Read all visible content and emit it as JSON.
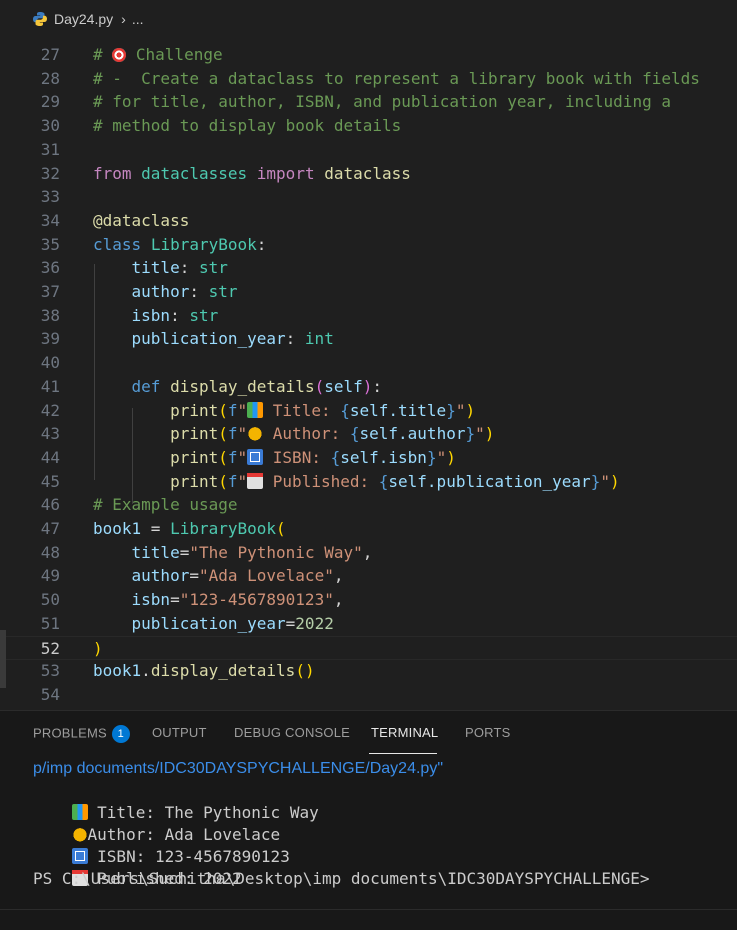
{
  "breadcrumb": {
    "file": "Day24.py",
    "ellipsis": "..."
  },
  "editor": {
    "cut_line_number": "26",
    "active_line": 52,
    "lines": [
      {
        "n": "27",
        "tokens": [
          [
            "c-com",
            "# "
          ],
          [
            "target-emoji",
            ""
          ],
          [
            "c-com",
            " Challenge"
          ]
        ]
      },
      {
        "n": "28",
        "tokens": [
          [
            "c-com",
            "# -  Create a dataclass to represent a library book with fields"
          ]
        ]
      },
      {
        "n": "29",
        "tokens": [
          [
            "c-com",
            "# for title, author, ISBN, and publication year, including a"
          ]
        ]
      },
      {
        "n": "30",
        "tokens": [
          [
            "c-com",
            "# method to display book details"
          ]
        ]
      },
      {
        "n": "31",
        "tokens": []
      },
      {
        "n": "32",
        "tokens": [
          [
            "c-imp",
            "from"
          ],
          [
            "c-txt",
            " "
          ],
          [
            "c-cls",
            "dataclasses"
          ],
          [
            "c-txt",
            " "
          ],
          [
            "c-imp",
            "import"
          ],
          [
            "c-txt",
            " "
          ],
          [
            "c-fn",
            "dataclass"
          ]
        ]
      },
      {
        "n": "33",
        "tokens": []
      },
      {
        "n": "34",
        "tokens": [
          [
            "c-fn",
            "@dataclass"
          ]
        ]
      },
      {
        "n": "35",
        "tokens": [
          [
            "c-kw",
            "class"
          ],
          [
            "c-txt",
            " "
          ],
          [
            "c-cls",
            "LibraryBook"
          ],
          [
            "c-txt",
            ":"
          ]
        ]
      },
      {
        "n": "36",
        "tokens": [
          [
            "c-txt",
            "    "
          ],
          [
            "c-var",
            "title"
          ],
          [
            "c-txt",
            ": "
          ],
          [
            "c-cls",
            "str"
          ]
        ]
      },
      {
        "n": "37",
        "tokens": [
          [
            "c-txt",
            "    "
          ],
          [
            "c-var",
            "author"
          ],
          [
            "c-txt",
            ": "
          ],
          [
            "c-cls",
            "str"
          ]
        ]
      },
      {
        "n": "38",
        "tokens": [
          [
            "c-txt",
            "    "
          ],
          [
            "c-var",
            "isbn"
          ],
          [
            "c-txt",
            ": "
          ],
          [
            "c-cls",
            "str"
          ]
        ]
      },
      {
        "n": "39",
        "tokens": [
          [
            "c-txt",
            "    "
          ],
          [
            "c-var",
            "publication_year"
          ],
          [
            "c-txt",
            ": "
          ],
          [
            "c-cls",
            "int"
          ]
        ]
      },
      {
        "n": "40",
        "tokens": []
      },
      {
        "n": "41",
        "tokens": [
          [
            "c-txt",
            "    "
          ],
          [
            "c-kw",
            "def"
          ],
          [
            "c-txt",
            " "
          ],
          [
            "c-fn",
            "display_details"
          ],
          [
            "c-brc2",
            "("
          ],
          [
            "c-var",
            "self"
          ],
          [
            "c-brc2",
            ")"
          ],
          [
            "c-txt",
            ":"
          ]
        ]
      },
      {
        "n": "42",
        "tokens": [
          [
            "c-txt",
            "        "
          ],
          [
            "c-fn",
            "print"
          ],
          [
            "c-brc",
            "("
          ],
          [
            "c-kw",
            "f"
          ],
          [
            "c-str",
            "\""
          ],
          [
            "books-emoji",
            ""
          ],
          [
            "c-str",
            " Title: "
          ],
          [
            "c-kw",
            "{"
          ],
          [
            "c-var",
            "self.title"
          ],
          [
            "c-kw",
            "}"
          ],
          [
            "c-str",
            "\""
          ],
          [
            "c-brc",
            ")"
          ]
        ]
      },
      {
        "n": "43",
        "tokens": [
          [
            "c-txt",
            "        "
          ],
          [
            "c-fn",
            "print"
          ],
          [
            "c-brc",
            "("
          ],
          [
            "c-kw",
            "f"
          ],
          [
            "c-str",
            "\""
          ],
          [
            "hand-emoji",
            ""
          ],
          [
            "c-str",
            " Author: "
          ],
          [
            "c-kw",
            "{"
          ],
          [
            "c-var",
            "self.author"
          ],
          [
            "c-kw",
            "}"
          ],
          [
            "c-str",
            "\""
          ],
          [
            "c-brc",
            ")"
          ]
        ]
      },
      {
        "n": "44",
        "tokens": [
          [
            "c-txt",
            "        "
          ],
          [
            "c-fn",
            "print"
          ],
          [
            "c-brc",
            "("
          ],
          [
            "c-kw",
            "f"
          ],
          [
            "c-str",
            "\""
          ],
          [
            "num-emoji",
            ""
          ],
          [
            "c-str",
            " ISBN: "
          ],
          [
            "c-kw",
            "{"
          ],
          [
            "c-var",
            "self.isbn"
          ],
          [
            "c-kw",
            "}"
          ],
          [
            "c-str",
            "\""
          ],
          [
            "c-brc",
            ")"
          ]
        ]
      },
      {
        "n": "45",
        "tokens": [
          [
            "c-txt",
            "        "
          ],
          [
            "c-fn",
            "print"
          ],
          [
            "c-brc",
            "("
          ],
          [
            "c-kw",
            "f"
          ],
          [
            "c-str",
            "\""
          ],
          [
            "cal-emoji",
            ""
          ],
          [
            "c-str",
            " Published: "
          ],
          [
            "c-kw",
            "{"
          ],
          [
            "c-var",
            "self.publication_year"
          ],
          [
            "c-kw",
            "}"
          ],
          [
            "c-str",
            "\""
          ],
          [
            "c-brc",
            ")"
          ]
        ]
      },
      {
        "n": "46",
        "tokens": [
          [
            "c-com",
            "# Example usage"
          ]
        ]
      },
      {
        "n": "47",
        "tokens": [
          [
            "c-var",
            "book1"
          ],
          [
            "c-txt",
            " = "
          ],
          [
            "c-cls",
            "LibraryBook"
          ],
          [
            "c-brc",
            "("
          ]
        ]
      },
      {
        "n": "48",
        "tokens": [
          [
            "c-txt",
            "    "
          ],
          [
            "c-var",
            "title"
          ],
          [
            "c-txt",
            "="
          ],
          [
            "c-str",
            "\"The Pythonic Way\""
          ],
          [
            "c-txt",
            ","
          ]
        ]
      },
      {
        "n": "49",
        "tokens": [
          [
            "c-txt",
            "    "
          ],
          [
            "c-var",
            "author"
          ],
          [
            "c-txt",
            "="
          ],
          [
            "c-str",
            "\"Ada Lovelace\""
          ],
          [
            "c-txt",
            ","
          ]
        ]
      },
      {
        "n": "50",
        "tokens": [
          [
            "c-txt",
            "    "
          ],
          [
            "c-var",
            "isbn"
          ],
          [
            "c-txt",
            "="
          ],
          [
            "c-str",
            "\"123-4567890123\""
          ],
          [
            "c-txt",
            ","
          ]
        ]
      },
      {
        "n": "51",
        "tokens": [
          [
            "c-txt",
            "    "
          ],
          [
            "c-var",
            "publication_year"
          ],
          [
            "c-txt",
            "="
          ],
          [
            "c-num",
            "2022"
          ]
        ]
      },
      {
        "n": "52",
        "tokens": [
          [
            "c-brc",
            ")"
          ]
        ]
      },
      {
        "n": "53",
        "tokens": [
          [
            "c-var",
            "book1"
          ],
          [
            "c-txt",
            "."
          ],
          [
            "c-fn",
            "display_details"
          ],
          [
            "c-brc",
            "()"
          ]
        ]
      },
      {
        "n": "54",
        "tokens": []
      }
    ]
  },
  "panel": {
    "tabs": [
      {
        "label": "PROBLEMS",
        "badge": "1"
      },
      {
        "label": "OUTPUT"
      },
      {
        "label": "DEBUG CONSOLE"
      },
      {
        "label": "TERMINAL",
        "active": true
      },
      {
        "label": "PORTS"
      }
    ],
    "terminal": {
      "command_tail": "p/imp documents/IDC30DAYSPYCHALLENGE/Day24.py\"",
      "output": [
        {
          "icon": "books-emoji",
          "text": " Title: The Pythonic Way"
        },
        {
          "icon": "hand-emoji",
          "text": "Author: Ada Lovelace"
        },
        {
          "icon": "num-emoji",
          "text": " ISBN: 123-4567890123"
        },
        {
          "icon": "cal-emoji",
          "text": " Published: 2022"
        }
      ],
      "prompt": "PS C:\\Users\\Suchitha\\Desktop\\imp documents\\IDC30DAYSPYCHALLENGE>"
    }
  },
  "colors": {
    "background": "#1f1f1f",
    "comment": "#6a9955",
    "keyword": "#569cd6",
    "string": "#ce9178",
    "badge": "#0078d4"
  }
}
